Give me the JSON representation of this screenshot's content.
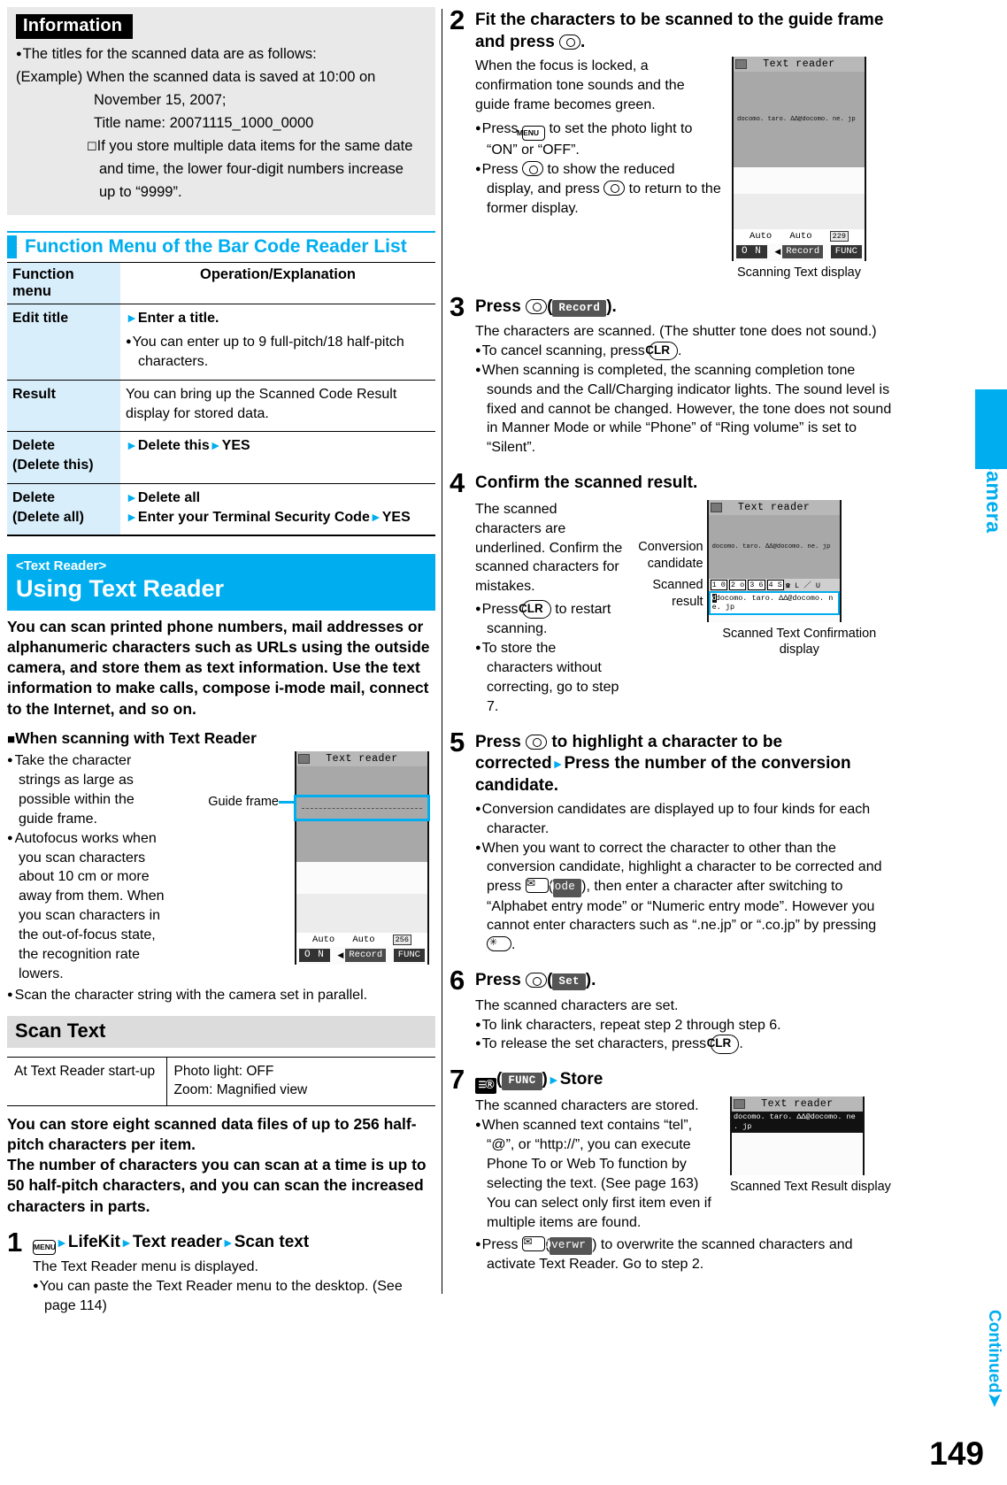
{
  "page": {
    "number": "149",
    "side_tab": "Camera",
    "continued": "Continued",
    "continued_arrow": "➤"
  },
  "information": {
    "heading": "Information",
    "lines": [
      {
        "style": "bullet",
        "text": "The titles for the scanned data are as follows:"
      },
      {
        "style": "example",
        "label": "(Example)",
        "text": "When the scanned data is saved at 10:00 on"
      },
      {
        "style": "indent1",
        "text": "November 15, 2007;"
      },
      {
        "style": "indent1",
        "text": "Title name: 20071115_1000_0000"
      },
      {
        "style": "indent2",
        "text": "If you store multiple data items for the same date"
      },
      {
        "style": "indent3",
        "text": "and time, the lower four-digit numbers increase"
      },
      {
        "style": "indent3",
        "text": "up to “9999”."
      }
    ]
  },
  "function_menu_section": {
    "title": "Function Menu of the Bar Code Reader List",
    "columns": [
      "Function menu",
      "Operation/Explanation"
    ],
    "rows": [
      {
        "menu": "Edit title",
        "menu2": "",
        "op_main": "Enter a title.",
        "op_arrow": true,
        "op_notes": [
          "You can enter up to 9 full-pitch/18 half-pitch characters."
        ]
      },
      {
        "menu": "Result",
        "menu2": "",
        "op_plain": "You can bring up the Scanned Code Result display for stored data."
      },
      {
        "menu": "Delete",
        "menu2": "(Delete this)",
        "op_seq": [
          "Delete this",
          "YES"
        ]
      },
      {
        "menu": "Delete",
        "menu2": "(Delete all)",
        "op_seq2": [
          "Delete all"
        ],
        "op_seq3": [
          "Enter your Terminal Security Code",
          "YES"
        ]
      }
    ]
  },
  "text_reader": {
    "sub_title": "<Text Reader>",
    "title": "Using Text Reader",
    "lead": "You can scan printed phone numbers, mail addresses or alphanumeric characters such as URLs using the outside camera, and store them as text information. Use the text information to make calls, compose i-mode mail, connect to the Internet, and so on.",
    "sub_heading": "When scanning with Text Reader",
    "bullets": [
      "Take the character strings as large as possible within the guide frame.",
      "Autofocus works when you scan characters about 10 cm or more away from them. When you scan characters in the out-of-focus state, the recognition rate lowers.",
      "Scan the character string with the camera set in parallel."
    ],
    "guide_frame_label": "Guide frame",
    "lcd1": {
      "title": "Text reader",
      "auto_left": "Auto",
      "auto_right": "Auto",
      "counter": "256",
      "soft_left": "O N",
      "soft_center": "Record",
      "soft_right": "FUNC"
    }
  },
  "scan_text": {
    "heading": "Scan Text",
    "startup_table": {
      "key": "At Text Reader start-up",
      "values": [
        "Photo light: OFF",
        "Zoom: Magnified view"
      ]
    },
    "intro": [
      "You can store eight scanned data files of up to 256 half-pitch characters per item.",
      "The number of characters you can scan at a time is up to 50 half-pitch characters, and you can scan the increased characters in parts."
    ],
    "steps": [
      {
        "num": "1",
        "title_parts": [
          {
            "type": "key-menu",
            "label": "MENU"
          },
          {
            "type": "arrow"
          },
          {
            "type": "text",
            "text": "LifeKit"
          },
          {
            "type": "arrow"
          },
          {
            "type": "text",
            "text": "Text reader"
          },
          {
            "type": "arrow"
          },
          {
            "type": "text",
            "text": "Scan text"
          }
        ],
        "body": "The Text Reader menu is displayed.",
        "notes": [
          "You can paste the Text Reader menu to the desktop. (See page 114)"
        ]
      },
      {
        "num": "2",
        "title": "Fit the characters to be scanned to the guide frame and press",
        "title_key": "o-key",
        "title_tail": ".",
        "body": "When the focus is locked, a confirmation tone sounds and the guide frame becomes green.",
        "notes": [
          "Press [MENU] to set the photo light to “ON” or “OFF”.",
          "Press [o] to show the reduced display, and press [o] to return to the former display."
        ],
        "lcd": {
          "title": "Text reader",
          "scan_text": "docomo. taro. ΔΔ@docomo. ne. jp",
          "auto_left": "Auto",
          "auto_right": "Auto",
          "counter": "229",
          "soft_left": "O N",
          "soft_center": "Record",
          "soft_right": "FUNC"
        },
        "caption": "Scanning Text display"
      },
      {
        "num": "3",
        "title": "Press",
        "title_key": "o-key",
        "title_lcdkey": "Record",
        "body": "The characters are scanned. (The shutter tone does not sound.)",
        "notes": [
          "To cancel scanning, press [CLR].",
          "When scanning is completed, the scanning completion tone sounds and the Call/Charging indicator lights. The sound level is fixed and cannot be changed. However, the tone does not sound in Manner Mode or while “Phone” of “Ring volume” is set to “Silent”."
        ]
      },
      {
        "num": "4",
        "title": "Confirm the scanned result.",
        "body": "The scanned characters are underlined. Confirm the scanned characters for mistakes.",
        "notes": [
          "Press [CLR] to restart scanning.",
          "To store the characters without correcting, go to step 7."
        ],
        "labels": {
          "conversion": "Conversion candidate",
          "scanned": "Scanned result"
        },
        "lcd": {
          "title": "Text reader",
          "scan_text": "docomo. taro. ΔΔ@docomo. ne. jp",
          "candidates": [
            "1 0",
            "2 o",
            "3 6",
            "4 S"
          ],
          "candidate_tail": "☎ L ／ U",
          "result_line1": "docomo. taro. ΔΔ@docomo. n",
          "result_line2": "e. jp"
        },
        "caption": "Scanned Text Confirmation display"
      },
      {
        "num": "5",
        "title": "Press [Mo] to highlight a character to be corrected▶Press the number of the conversion candidate.",
        "notes": [
          "Conversion candidates are displayed up to four kinds for each character.",
          "When you want to correct the character to other than the conversion candidate, highlight a character to be corrected and press [mail](Mode), then enter a character after switching to “Alphabet entry mode” or “Numeric entry mode”. However you cannot enter characters such as “.ne.jp” or “.co.jp” by pressing [*]."
        ]
      },
      {
        "num": "6",
        "title": "Press",
        "title_key": "o-key",
        "title_lcdkey": "Set",
        "body": "The scanned characters are set.",
        "notes": [
          "To link characters, repeat step 2 through step 6.",
          "To release the set characters, press [CLR]."
        ]
      },
      {
        "num": "7",
        "title_lcdkey": "FUNC",
        "title_tail": "Store",
        "body": "The scanned characters are stored.",
        "notes": [
          "When scanned text contains “tel”, “@”, or “http://”, you can execute Phone To or Web To function by selecting the text. (See page 163) You can select only first item even if multiple items are found.",
          "Press [mail](Overwr) to overwrite the scanned characters and activate Text Reader. Go to step 2."
        ],
        "lcd": {
          "title": "Text reader",
          "line1": "docomo. taro. ΔΔ@docomo. ne",
          "line2": ". jp"
        },
        "caption": "Scanned Text Result display"
      }
    ]
  },
  "keys": {
    "menu": "MENU",
    "clr": "CLR",
    "func": "FUNC",
    "record": "Record",
    "set": "Set",
    "mode": "Mode",
    "overwr": "Overwr"
  },
  "colors": {
    "accent": "#00aeef",
    "table_key_bg": "#d9eefb",
    "info_bg": "#e9e9e9",
    "grey_head": "#dcdcdc"
  }
}
